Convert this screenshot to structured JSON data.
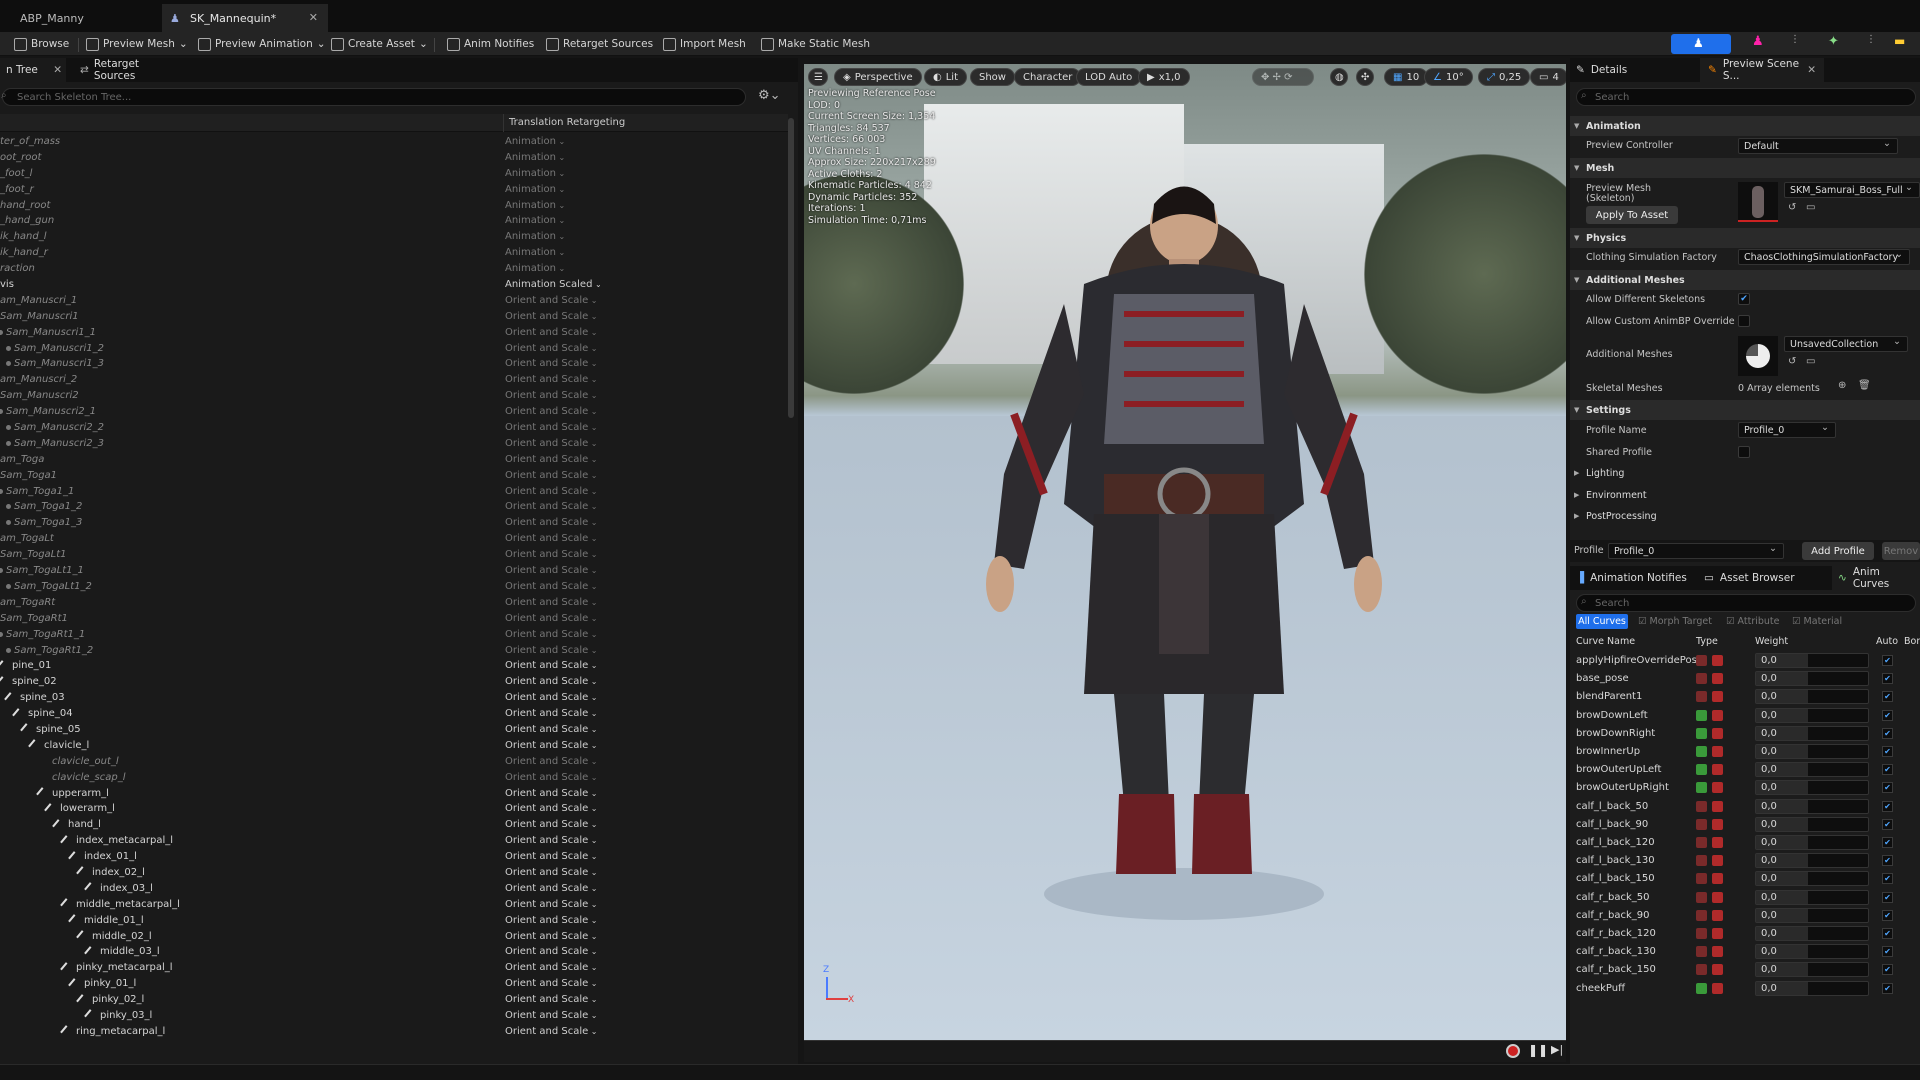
{
  "doc_tabs": [
    {
      "label": "ABP_Manny"
    },
    {
      "label": "SK_Mannequin*"
    }
  ],
  "toolbar": {
    "browse": "Browse",
    "preview_mesh": "Preview Mesh",
    "preview_animation": "Preview Animation",
    "create_asset": "Create Asset",
    "anim_notifies": "Anim Notifies",
    "retarget_sources": "Retarget Sources",
    "import_mesh": "Import Mesh",
    "make_static_mesh": "Make Static Mesh"
  },
  "skeleton_panel": {
    "tab_tree": "n Tree",
    "tab_retarget": "Retarget Sources",
    "search_placeholder": "Search Skeleton Tree...",
    "column_header": "Translation Retargeting",
    "rows": [
      {
        "name": "ter_of_mass",
        "mode": "Animation"
      },
      {
        "name": "oot_root",
        "mode": "Animation"
      },
      {
        "name": "_foot_l",
        "mode": "Animation"
      },
      {
        "name": "_foot_r",
        "mode": "Animation"
      },
      {
        "name": "hand_root",
        "mode": "Animation"
      },
      {
        "name": "_hand_gun",
        "mode": "Animation"
      },
      {
        "name": "ik_hand_l",
        "mode": "Animation"
      },
      {
        "name": "ik_hand_r",
        "mode": "Animation"
      },
      {
        "name": "raction",
        "mode": "Animation"
      },
      {
        "name": "vis",
        "mode": "Animation Scaled"
      },
      {
        "name": "am_Manuscri_1",
        "mode": "Orient and Scale"
      },
      {
        "name": "Sam_Manuscri1",
        "mode": "Orient and Scale"
      },
      {
        "name": "Sam_Manuscri1_1",
        "mode": "Orient and Scale"
      },
      {
        "name": "Sam_Manuscri1_2",
        "mode": "Orient and Scale"
      },
      {
        "name": "Sam_Manuscri1_3",
        "mode": "Orient and Scale"
      },
      {
        "name": "am_Manuscri_2",
        "mode": "Orient and Scale"
      },
      {
        "name": "Sam_Manuscri2",
        "mode": "Orient and Scale"
      },
      {
        "name": "Sam_Manuscri2_1",
        "mode": "Orient and Scale"
      },
      {
        "name": "Sam_Manuscri2_2",
        "mode": "Orient and Scale"
      },
      {
        "name": "Sam_Manuscri2_3",
        "mode": "Orient and Scale"
      },
      {
        "name": "am_Toga",
        "mode": "Orient and Scale"
      },
      {
        "name": "Sam_Toga1",
        "mode": "Orient and Scale"
      },
      {
        "name": "Sam_Toga1_1",
        "mode": "Orient and Scale"
      },
      {
        "name": "Sam_Toga1_2",
        "mode": "Orient and Scale"
      },
      {
        "name": "Sam_Toga1_3",
        "mode": "Orient and Scale"
      },
      {
        "name": "am_TogaLt",
        "mode": "Orient and Scale"
      },
      {
        "name": "Sam_TogaLt1",
        "mode": "Orient and Scale"
      },
      {
        "name": "Sam_TogaLt1_1",
        "mode": "Orient and Scale"
      },
      {
        "name": "Sam_TogaLt1_2",
        "mode": "Orient and Scale"
      },
      {
        "name": "am_TogaRt",
        "mode": "Orient and Scale"
      },
      {
        "name": "Sam_TogaRt1",
        "mode": "Orient and Scale"
      },
      {
        "name": "Sam_TogaRt1_1",
        "mode": "Orient and Scale"
      },
      {
        "name": "Sam_TogaRt1_2",
        "mode": "Orient and Scale"
      },
      {
        "name": "pine_01",
        "mode": "Orient and Scale"
      },
      {
        "name": "spine_02",
        "mode": "Orient and Scale"
      },
      {
        "name": "spine_03",
        "mode": "Orient and Scale"
      },
      {
        "name": "spine_04",
        "mode": "Orient and Scale"
      },
      {
        "name": "spine_05",
        "mode": "Orient and Scale"
      },
      {
        "name": "clavicle_l",
        "mode": "Orient and Scale"
      },
      {
        "name": "clavicle_out_l",
        "mode": "Orient and Scale"
      },
      {
        "name": "clavicle_scap_l",
        "mode": "Orient and Scale"
      },
      {
        "name": "upperarm_l",
        "mode": "Orient and Scale"
      },
      {
        "name": "lowerarm_l",
        "mode": "Orient and Scale"
      },
      {
        "name": "hand_l",
        "mode": "Orient and Scale"
      },
      {
        "name": "index_metacarpal_l",
        "mode": "Orient and Scale"
      },
      {
        "name": "index_01_l",
        "mode": "Orient and Scale"
      },
      {
        "name": "index_02_l",
        "mode": "Orient and Scale"
      },
      {
        "name": "index_03_l",
        "mode": "Orient and Scale"
      },
      {
        "name": "middle_metacarpal_l",
        "mode": "Orient and Scale"
      },
      {
        "name": "middle_01_l",
        "mode": "Orient and Scale"
      },
      {
        "name": "middle_02_l",
        "mode": "Orient and Scale"
      },
      {
        "name": "middle_03_l",
        "mode": "Orient and Scale"
      },
      {
        "name": "pinky_metacarpal_l",
        "mode": "Orient and Scale"
      },
      {
        "name": "pinky_01_l",
        "mode": "Orient and Scale"
      },
      {
        "name": "pinky_02_l",
        "mode": "Orient and Scale"
      },
      {
        "name": "pinky_03_l",
        "mode": "Orient and Scale"
      },
      {
        "name": "ring_metacarpal_l",
        "mode": "Orient and Scale"
      }
    ]
  },
  "viewport": {
    "perspective": "Perspective",
    "lit": "Lit",
    "show": "Show",
    "character": "Character",
    "lod": "LOD Auto",
    "speed": "x1,0",
    "grid_value": "10",
    "angle_value": "10°",
    "scale_value": "0,25",
    "camera_speed": "4",
    "info_lines": [
      "Previewing Reference Pose",
      "LOD: 0",
      "Current Screen Size: 1,354",
      "Triangles: 84 537",
      "Vertices: 66 003",
      "UV Channels: 1",
      "Approx Size: 220x217x289",
      "Active Cloths: 2",
      "Kinematic Particles: 4 842",
      "Dynamic Particles: 352",
      "Iterations: 1",
      "Simulation Time: 0,71ms"
    ],
    "axis_z": "Z",
    "axis_x": "X"
  },
  "details": {
    "tab_details": "Details",
    "tab_preview": "Preview Scene S...",
    "search_placeholder": "Search",
    "sections": {
      "animation": "Animation",
      "mesh": "Mesh",
      "physics": "Physics",
      "additional_meshes": "Additional Meshes",
      "settings": "Settings",
      "lighting": "Lighting",
      "environment": "Environment",
      "postprocessing": "PostProcessing"
    },
    "preview_controller_label": "Preview Controller",
    "preview_controller_value": "Default",
    "preview_mesh_label": "Preview Mesh",
    "preview_mesh_sub": "(Skeleton)",
    "preview_mesh_value": "SKM_Samurai_Boss_Full",
    "apply_to_asset": "Apply To Asset",
    "clothing_factory_label": "Clothing Simulation Factory",
    "clothing_factory_value": "ChaosClothingSimulationFactory",
    "allow_diff_skel_label": "Allow Different Skeletons",
    "allow_custom_label": "Allow Custom AnimBP Override",
    "additional_meshes_label": "Additional Meshes",
    "additional_meshes_value": "UnsavedCollection",
    "skeletal_meshes_label": "Skeletal Meshes",
    "skeletal_meshes_value": "0 Array elements",
    "profile_name_label": "Profile Name",
    "profile_name_value": "Profile_0",
    "shared_profile_label": "Shared Profile",
    "profile_label": "Profile",
    "profile_value": "Profile_0",
    "add_profile": "Add Profile",
    "remove_profile": "Remov"
  },
  "curves": {
    "tab_notifies": "Animation Notifies",
    "tab_assets": "Asset Browser",
    "tab_curves": "Anim Curves",
    "search_placeholder": "Search",
    "filter_all": "All Curves",
    "filter_morph": "Morph Target",
    "filter_attr": "Attribute",
    "filter_material": "Material",
    "col_name": "Curve Name",
    "col_type": "Type",
    "col_weight": "Weight",
    "col_auto": "Auto",
    "col_bone": "Bon",
    "rows": [
      {
        "name": "applyHipfireOverridePos",
        "weight": "0,0",
        "morph": false
      },
      {
        "name": "base_pose",
        "weight": "0,0",
        "morph": false
      },
      {
        "name": "blendParent1",
        "weight": "0,0",
        "morph": false
      },
      {
        "name": "browDownLeft",
        "weight": "0,0",
        "morph": true
      },
      {
        "name": "browDownRight",
        "weight": "0,0",
        "morph": true
      },
      {
        "name": "browInnerUp",
        "weight": "0,0",
        "morph": true
      },
      {
        "name": "browOuterUpLeft",
        "weight": "0,0",
        "morph": true
      },
      {
        "name": "browOuterUpRight",
        "weight": "0,0",
        "morph": true
      },
      {
        "name": "calf_l_back_50",
        "weight": "0,0",
        "morph": false
      },
      {
        "name": "calf_l_back_90",
        "weight": "0,0",
        "morph": false
      },
      {
        "name": "calf_l_back_120",
        "weight": "0,0",
        "morph": false
      },
      {
        "name": "calf_l_back_130",
        "weight": "0,0",
        "morph": false
      },
      {
        "name": "calf_l_back_150",
        "weight": "0,0",
        "morph": false
      },
      {
        "name": "calf_r_back_50",
        "weight": "0,0",
        "morph": false
      },
      {
        "name": "calf_r_back_90",
        "weight": "0,0",
        "morph": false
      },
      {
        "name": "calf_r_back_120",
        "weight": "0,0",
        "morph": false
      },
      {
        "name": "calf_r_back_130",
        "weight": "0,0",
        "morph": false
      },
      {
        "name": "calf_r_back_150",
        "weight": "0,0",
        "morph": false
      },
      {
        "name": "cheekPuff",
        "weight": "0,0",
        "morph": true
      }
    ]
  },
  "colors": {
    "accent": "#1f6feb",
    "selected": "#2a64c8"
  }
}
